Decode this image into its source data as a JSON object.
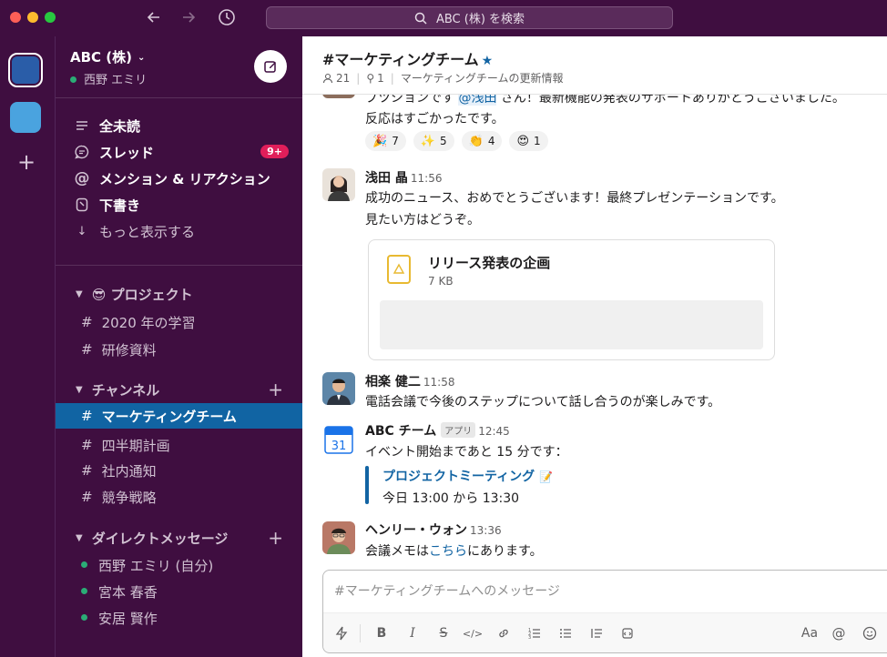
{
  "titlebar": {
    "search_placeholder": "ABC (株) を検索"
  },
  "workspace": {
    "name": "ABC (株)",
    "user": "西野 エミリ"
  },
  "sidebar": {
    "nav": [
      {
        "label": "全未読",
        "icon": "unreads-icon"
      },
      {
        "label": "スレッド",
        "icon": "threads-icon",
        "badge": "9+"
      },
      {
        "label": "メンション & リアクション",
        "icon": "mention-icon"
      },
      {
        "label": "下書き",
        "icon": "drafts-icon"
      },
      {
        "label": "もっと表示する",
        "icon": "arrow-down-icon"
      }
    ],
    "project_section": {
      "label": "😎 プロジェクト",
      "channels": [
        "2020 年の学習",
        "研修資料"
      ]
    },
    "channel_section": {
      "label": "チャンネル",
      "channels": [
        "マーケティングチーム",
        "四半期計画",
        "社内通知",
        "競争戦略"
      ]
    },
    "dm_section": {
      "label": "ダイレクトメッセージ",
      "people": [
        "西野 エミリ (自分)",
        "宮本 春香",
        "安居 賢作"
      ]
    }
  },
  "channel": {
    "title": "#マーケティングチーム",
    "members": "21",
    "pins": "1",
    "topic": "マーケティングチームの更新情報"
  },
  "messages": {
    "partial": {
      "line1_pre": "ブツションです ",
      "line1_mention": "@浅田",
      "line1_post": " さん！最新機能の発表のサポートありがとうございました。",
      "line2": "反応はすごかったです。",
      "reactions": [
        {
          "emoji": "🎉",
          "count": "7"
        },
        {
          "emoji": "✨",
          "count": "5"
        },
        {
          "emoji": "👏",
          "count": "4"
        },
        {
          "emoji": "😍",
          "count": "1"
        }
      ]
    },
    "asada": {
      "name": "浅田 晶",
      "time": "11:56",
      "line1": "成功のニュース、おめでとうございます！最終プレゼンテーションです。",
      "line2": "見たい方はどうぞ。",
      "file_name": "リリース発表の企画",
      "file_size": "7 KB"
    },
    "sagara": {
      "name": "相楽 健二",
      "time": "11:58",
      "text": "電話会議で今後のステップについて話し合うのが楽しみです。"
    },
    "abc_team": {
      "name": "ABC チーム",
      "tag": "アプリ",
      "time": "12:45",
      "calendar_day": "31",
      "text": "イベント開始まであと 15 分です：",
      "event_title": "プロジェクトミーティング",
      "event_time": "今日 13:00 から 13:30"
    },
    "henry": {
      "name": "ヘンリー・ウォン",
      "time": "13:36",
      "text_pre": "会議メモは",
      "text_link": "こちら",
      "text_post": "にあります。"
    }
  },
  "composer": {
    "placeholder": "#マーケティングチームへのメッセージ",
    "format_label": "Aa"
  }
}
